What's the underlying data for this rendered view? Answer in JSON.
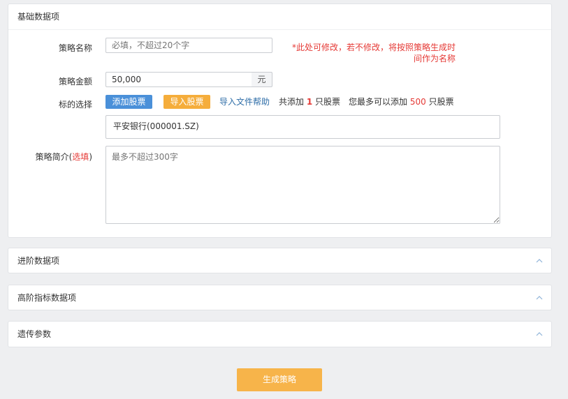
{
  "basic": {
    "title": "基础数据项",
    "name_label": "策略名称",
    "name_placeholder": "必填，不超过20个字",
    "name_note": "*此处可修改，若不修改，将按照策略生成时间作为名称",
    "amount_label": "策略金额",
    "amount_value": "50,000",
    "amount_unit": "元",
    "target_label": "标的选择",
    "add_stock_btn": "添加股票",
    "import_stock_btn": "导入股票",
    "import_help_link": "导入文件帮助",
    "added_prefix": "共添加",
    "added_count": "1",
    "added_suffix": "只股票",
    "max_prefix": "您最多可以添加",
    "max_count": "500",
    "max_suffix": "只股票",
    "selected_stock": "平安银行(000001.SZ)",
    "intro_label": "策略简介(",
    "intro_optional": "选填",
    "intro_label_end": ")",
    "intro_placeholder": "最多不超过300字"
  },
  "advanced": {
    "title": "进阶数据项"
  },
  "high": {
    "title": "高阶指标数据项"
  },
  "genetic": {
    "title": "遗传参数"
  },
  "actions": {
    "generate_btn": "生成策略"
  },
  "icons": {
    "collapse": "chevron-up-icon"
  }
}
